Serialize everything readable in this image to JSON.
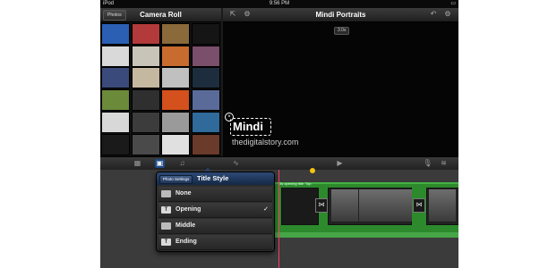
{
  "status_bar": {
    "carrier": "iPod",
    "time": "9:56 PM",
    "battery": "▭"
  },
  "left_header": {
    "back_label": "Photos",
    "title": "Camera Roll"
  },
  "right_header": {
    "title": "Mindi Portraits"
  },
  "preview": {
    "duration_badge": "3.0s",
    "title_text": "Mindi",
    "watermark": "thedigitalstory.com"
  },
  "thumb_colors": [
    "#2a5fb4",
    "#b33a3a",
    "#8a6a3a",
    "#151515",
    "#d9d9d9",
    "#c9c4b8",
    "#c86b2e",
    "#7a4f6b",
    "#3a4a7a",
    "#c4b8a0",
    "#c0c0c0",
    "#1d2d3d",
    "#6b8a3a",
    "#2f2f2f",
    "#d4501c",
    "#5a6b9a",
    "#d8d8d8",
    "#3c3c3c",
    "#9a9a9a",
    "#2f6a9a",
    "#1a1a1a",
    "#4a4a4a",
    "#e0e0e0",
    "#6a3a2a"
  ],
  "timeline": {
    "clip_label": "3s opening title: Top"
  },
  "popover": {
    "back_label": "Photo Settings",
    "title": "Title Style",
    "options": [
      {
        "label": "None",
        "checked": false
      },
      {
        "label": "Opening",
        "checked": true
      },
      {
        "label": "Middle",
        "checked": false
      },
      {
        "label": "Ending",
        "checked": false
      }
    ],
    "check_mark": "✓"
  },
  "colors": {
    "accent": "#1e4a86",
    "playhead": "#ff3b6b",
    "track": "#2c8a2c"
  }
}
